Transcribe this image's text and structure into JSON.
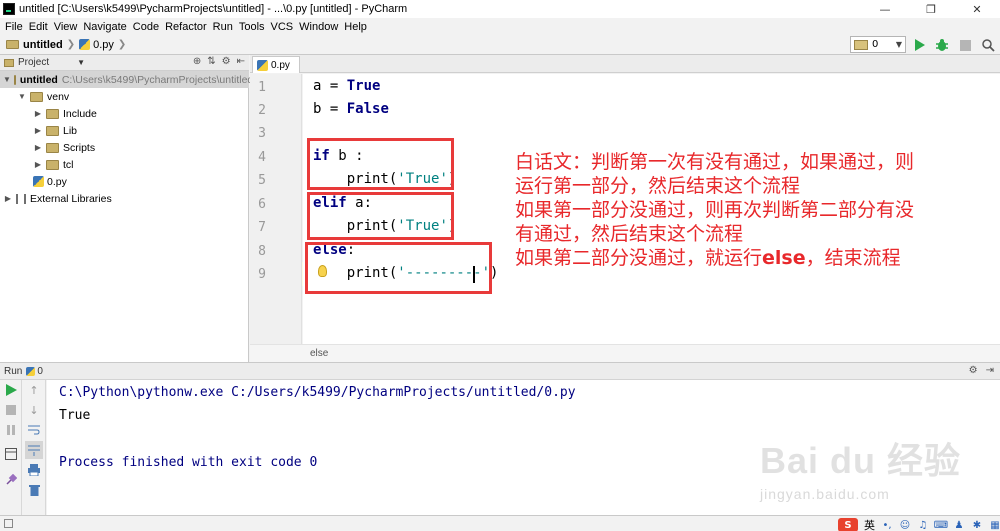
{
  "window": {
    "title": "untitled [C:\\Users\\k5499\\PycharmProjects\\untitled] - ...\\0.py [untitled] - PyCharm",
    "minimize_glyph": "—",
    "maximize_glyph": "❐",
    "close_glyph": "✕"
  },
  "menu": [
    "File",
    "Edit",
    "View",
    "Navigate",
    "Code",
    "Refactor",
    "Run",
    "Tools",
    "VCS",
    "Window",
    "Help"
  ],
  "navbar": {
    "project": "untitled",
    "file": "0.py",
    "run_config_value": "0"
  },
  "project_panel": {
    "title": "Project",
    "root_name": "untitled",
    "root_path": "C:\\Users\\k5499\\PycharmProjects\\untitled",
    "items": [
      {
        "label": "venv"
      },
      {
        "label": "Include"
      },
      {
        "label": "Lib"
      },
      {
        "label": "Scripts"
      },
      {
        "label": "tcl"
      },
      {
        "label": "0.py"
      },
      {
        "label": "External Libraries"
      }
    ]
  },
  "editor": {
    "tab": "0.py",
    "line_numbers": [
      "1",
      "2",
      "3",
      "4",
      "5",
      "6",
      "7",
      "8",
      "9"
    ],
    "lines": {
      "l1_var": "a",
      "l1_op": " = ",
      "l1_val": "True",
      "l2_var": "b",
      "l2_op": " = ",
      "l2_val": "False",
      "l4_kw": "if",
      "l4_rest": " b :",
      "l5_fn": "    print(",
      "l5_str": "'True'",
      "l5_end": ")",
      "l6_kw": "elif",
      "l6_rest": " a:",
      "l7_fn": "    print(",
      "l7_str": "'True'",
      "l7_end": ")",
      "l8_kw": "else",
      "l8_rest": ":",
      "l9_fn": "    print(",
      "l9_str": "'---------'",
      "l9_end": ")"
    },
    "status_text": "else"
  },
  "annotation": {
    "line1": "白话文：判断第一次有没有通过，如果通过，则",
    "line2": "运行第一部分，然后结束这个流程",
    "line3": "如果第一部分没通过，则再次判断第二部分有没",
    "line4": "有通过，然后结束这个流程",
    "line5_pre": "如果第二部分没通过，就运行",
    "line5_hl": "else",
    "line5_post": "，结束流程",
    "color": "#e8282b"
  },
  "run_panel": {
    "label": "Run",
    "config": "0",
    "console": {
      "command": "C:\\Python\\pythonw.exe C:/Users/k5499/PycharmProjects/untitled/0.py",
      "output": "True",
      "exit_message": "Process finished with exit code 0"
    }
  },
  "statusbar": {
    "ime_lang": "英"
  },
  "watermark": {
    "logo": "Bai du 经验",
    "url": "jingyan.baidu.com"
  },
  "colors": {
    "keyword": "#000080",
    "string": "#008080",
    "run_green": "#2ba94b",
    "annotation_box": "#e83a3a"
  }
}
